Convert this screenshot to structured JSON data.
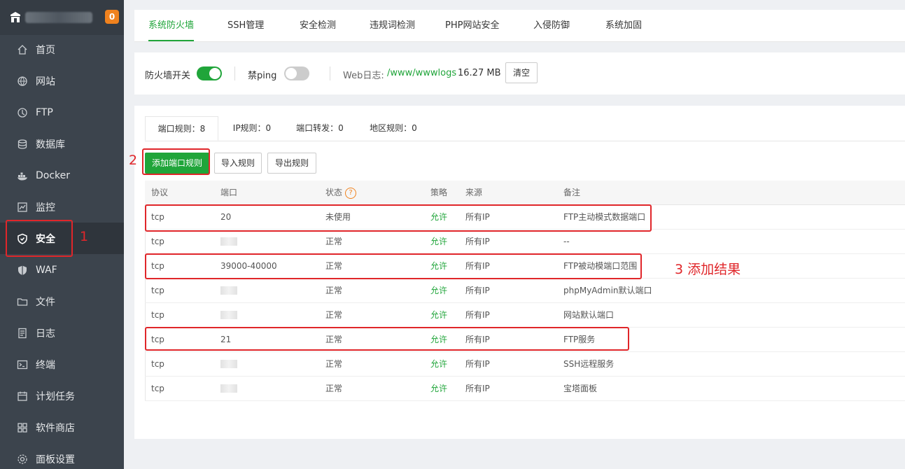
{
  "sidebar": {
    "badge": "0",
    "items": [
      {
        "label": "首页",
        "icon": "home-icon"
      },
      {
        "label": "网站",
        "icon": "globe-icon"
      },
      {
        "label": "FTP",
        "icon": "ftp-icon"
      },
      {
        "label": "数据库",
        "icon": "database-icon"
      },
      {
        "label": "Docker",
        "icon": "docker-icon"
      },
      {
        "label": "监控",
        "icon": "monitor-icon"
      },
      {
        "label": "安全",
        "icon": "shield-icon",
        "active": true
      },
      {
        "label": "WAF",
        "icon": "waf-shield-icon"
      },
      {
        "label": "文件",
        "icon": "folder-icon"
      },
      {
        "label": "日志",
        "icon": "log-icon"
      },
      {
        "label": "终端",
        "icon": "terminal-icon"
      },
      {
        "label": "计划任务",
        "icon": "calendar-icon"
      },
      {
        "label": "软件商店",
        "icon": "apps-icon"
      },
      {
        "label": "面板设置",
        "icon": "gear-icon"
      }
    ]
  },
  "topnav": {
    "tabs": [
      "系统防火墙",
      "SSH管理",
      "安全检测",
      "违规词检测",
      "PHP网站安全",
      "入侵防御",
      "系统加固"
    ]
  },
  "switchbar": {
    "firewall_label": "防火墙开关",
    "firewall_on": true,
    "ping_label": "禁ping",
    "ping_on": false,
    "weblog_label": "Web日志:",
    "weblog_path": "/www/wwwlogs",
    "weblog_size": "16.27 MB",
    "clear_label": "清空"
  },
  "panel": {
    "subtabs": [
      "端口规则：8",
      "IP规则：0",
      "端口转发：0",
      "地区规则：0"
    ],
    "add_label": "添加端口规则",
    "import_label": "导入规则",
    "export_label": "导出规则"
  },
  "table": {
    "headers": [
      "协议",
      "端口",
      "状态",
      "策略",
      "来源",
      "备注"
    ],
    "help_icon": "?",
    "rows": [
      {
        "proto": "tcp",
        "port": "20",
        "status": "未使用",
        "policy": "允许",
        "source": "所有IP",
        "note": "FTP主动模式数据端口"
      },
      {
        "proto": "tcp",
        "port": "",
        "status": "正常",
        "policy": "允许",
        "source": "所有IP",
        "note": "--"
      },
      {
        "proto": "tcp",
        "port": "39000-40000",
        "status": "正常",
        "policy": "允许",
        "source": "所有IP",
        "note": "FTP被动模端口范围"
      },
      {
        "proto": "tcp",
        "port": "",
        "status": "正常",
        "policy": "允许",
        "source": "所有IP",
        "note": "phpMyAdmin默认端口"
      },
      {
        "proto": "tcp",
        "port": "",
        "status": "正常",
        "policy": "允许",
        "source": "所有IP",
        "note": "网站默认端口"
      },
      {
        "proto": "tcp",
        "port": "21",
        "status": "正常",
        "policy": "允许",
        "source": "所有IP",
        "note": "FTP服务"
      },
      {
        "proto": "tcp",
        "port": "",
        "status": "正常",
        "policy": "允许",
        "source": "所有IP",
        "note": "SSH远程服务"
      },
      {
        "proto": "tcp",
        "port": "",
        "status": "正常",
        "policy": "允许",
        "source": "所有IP",
        "note": "宝塔面板"
      }
    ]
  },
  "annotations": {
    "n1": "1",
    "n2": "2",
    "n3": "3 添加结果"
  },
  "colors": {
    "accent": "#20a53a",
    "annotation": "#e0262a",
    "sidebar": "#3c444d",
    "badge": "#f0821e"
  }
}
